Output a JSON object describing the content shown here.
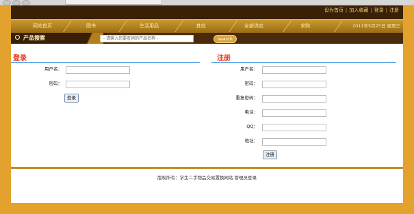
{
  "top_links": [
    "设为首页",
    "加入收藏",
    "登录",
    "注册"
  ],
  "nav": {
    "items": [
      "网站首页",
      "图书",
      "生活用品",
      "其他",
      "全部供应",
      "求购"
    ],
    "date": "2011年5月25日 星期三"
  },
  "search": {
    "title": "产品搜索",
    "placeholder": "- 请输入您要查询的产品名称 -",
    "button": "search"
  },
  "login": {
    "title": "登录",
    "fields": [
      {
        "label": "用户名：",
        "value": ""
      },
      {
        "label": "密码：",
        "value": ""
      }
    ],
    "button": "登录"
  },
  "register": {
    "title": "注册",
    "fields": [
      {
        "label": "用户名：",
        "value": ""
      },
      {
        "label": "密码：",
        "value": ""
      },
      {
        "label": "重复密码：",
        "value": ""
      },
      {
        "label": "电话：",
        "value": ""
      },
      {
        "label": "QQ：",
        "value": ""
      },
      {
        "label": "地址：",
        "value": ""
      }
    ],
    "button": "注册"
  },
  "footer": {
    "text": "版权所有：学生二手物品交易置换网站 管理员登录"
  }
}
